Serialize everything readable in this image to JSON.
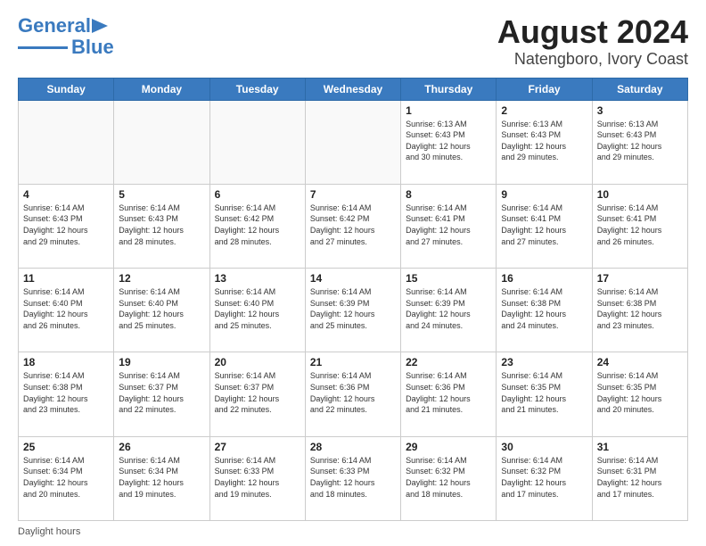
{
  "header": {
    "logo_line1": "General",
    "logo_line2": "Blue",
    "title": "August 2024",
    "subtitle": "Natengboro, Ivory Coast"
  },
  "calendar": {
    "days_of_week": [
      "Sunday",
      "Monday",
      "Tuesday",
      "Wednesday",
      "Thursday",
      "Friday",
      "Saturday"
    ],
    "weeks": [
      [
        {
          "day": "",
          "info": ""
        },
        {
          "day": "",
          "info": ""
        },
        {
          "day": "",
          "info": ""
        },
        {
          "day": "",
          "info": ""
        },
        {
          "day": "1",
          "info": "Sunrise: 6:13 AM\nSunset: 6:43 PM\nDaylight: 12 hours\nand 30 minutes."
        },
        {
          "day": "2",
          "info": "Sunrise: 6:13 AM\nSunset: 6:43 PM\nDaylight: 12 hours\nand 29 minutes."
        },
        {
          "day": "3",
          "info": "Sunrise: 6:13 AM\nSunset: 6:43 PM\nDaylight: 12 hours\nand 29 minutes."
        }
      ],
      [
        {
          "day": "4",
          "info": "Sunrise: 6:14 AM\nSunset: 6:43 PM\nDaylight: 12 hours\nand 29 minutes."
        },
        {
          "day": "5",
          "info": "Sunrise: 6:14 AM\nSunset: 6:43 PM\nDaylight: 12 hours\nand 28 minutes."
        },
        {
          "day": "6",
          "info": "Sunrise: 6:14 AM\nSunset: 6:42 PM\nDaylight: 12 hours\nand 28 minutes."
        },
        {
          "day": "7",
          "info": "Sunrise: 6:14 AM\nSunset: 6:42 PM\nDaylight: 12 hours\nand 27 minutes."
        },
        {
          "day": "8",
          "info": "Sunrise: 6:14 AM\nSunset: 6:41 PM\nDaylight: 12 hours\nand 27 minutes."
        },
        {
          "day": "9",
          "info": "Sunrise: 6:14 AM\nSunset: 6:41 PM\nDaylight: 12 hours\nand 27 minutes."
        },
        {
          "day": "10",
          "info": "Sunrise: 6:14 AM\nSunset: 6:41 PM\nDaylight: 12 hours\nand 26 minutes."
        }
      ],
      [
        {
          "day": "11",
          "info": "Sunrise: 6:14 AM\nSunset: 6:40 PM\nDaylight: 12 hours\nand 26 minutes."
        },
        {
          "day": "12",
          "info": "Sunrise: 6:14 AM\nSunset: 6:40 PM\nDaylight: 12 hours\nand 25 minutes."
        },
        {
          "day": "13",
          "info": "Sunrise: 6:14 AM\nSunset: 6:40 PM\nDaylight: 12 hours\nand 25 minutes."
        },
        {
          "day": "14",
          "info": "Sunrise: 6:14 AM\nSunset: 6:39 PM\nDaylight: 12 hours\nand 25 minutes."
        },
        {
          "day": "15",
          "info": "Sunrise: 6:14 AM\nSunset: 6:39 PM\nDaylight: 12 hours\nand 24 minutes."
        },
        {
          "day": "16",
          "info": "Sunrise: 6:14 AM\nSunset: 6:38 PM\nDaylight: 12 hours\nand 24 minutes."
        },
        {
          "day": "17",
          "info": "Sunrise: 6:14 AM\nSunset: 6:38 PM\nDaylight: 12 hours\nand 23 minutes."
        }
      ],
      [
        {
          "day": "18",
          "info": "Sunrise: 6:14 AM\nSunset: 6:38 PM\nDaylight: 12 hours\nand 23 minutes."
        },
        {
          "day": "19",
          "info": "Sunrise: 6:14 AM\nSunset: 6:37 PM\nDaylight: 12 hours\nand 22 minutes."
        },
        {
          "day": "20",
          "info": "Sunrise: 6:14 AM\nSunset: 6:37 PM\nDaylight: 12 hours\nand 22 minutes."
        },
        {
          "day": "21",
          "info": "Sunrise: 6:14 AM\nSunset: 6:36 PM\nDaylight: 12 hours\nand 22 minutes."
        },
        {
          "day": "22",
          "info": "Sunrise: 6:14 AM\nSunset: 6:36 PM\nDaylight: 12 hours\nand 21 minutes."
        },
        {
          "day": "23",
          "info": "Sunrise: 6:14 AM\nSunset: 6:35 PM\nDaylight: 12 hours\nand 21 minutes."
        },
        {
          "day": "24",
          "info": "Sunrise: 6:14 AM\nSunset: 6:35 PM\nDaylight: 12 hours\nand 20 minutes."
        }
      ],
      [
        {
          "day": "25",
          "info": "Sunrise: 6:14 AM\nSunset: 6:34 PM\nDaylight: 12 hours\nand 20 minutes."
        },
        {
          "day": "26",
          "info": "Sunrise: 6:14 AM\nSunset: 6:34 PM\nDaylight: 12 hours\nand 19 minutes."
        },
        {
          "day": "27",
          "info": "Sunrise: 6:14 AM\nSunset: 6:33 PM\nDaylight: 12 hours\nand 19 minutes."
        },
        {
          "day": "28",
          "info": "Sunrise: 6:14 AM\nSunset: 6:33 PM\nDaylight: 12 hours\nand 18 minutes."
        },
        {
          "day": "29",
          "info": "Sunrise: 6:14 AM\nSunset: 6:32 PM\nDaylight: 12 hours\nand 18 minutes."
        },
        {
          "day": "30",
          "info": "Sunrise: 6:14 AM\nSunset: 6:32 PM\nDaylight: 12 hours\nand 17 minutes."
        },
        {
          "day": "31",
          "info": "Sunrise: 6:14 AM\nSunset: 6:31 PM\nDaylight: 12 hours\nand 17 minutes."
        }
      ]
    ]
  },
  "footer": {
    "text": "Daylight hours"
  }
}
